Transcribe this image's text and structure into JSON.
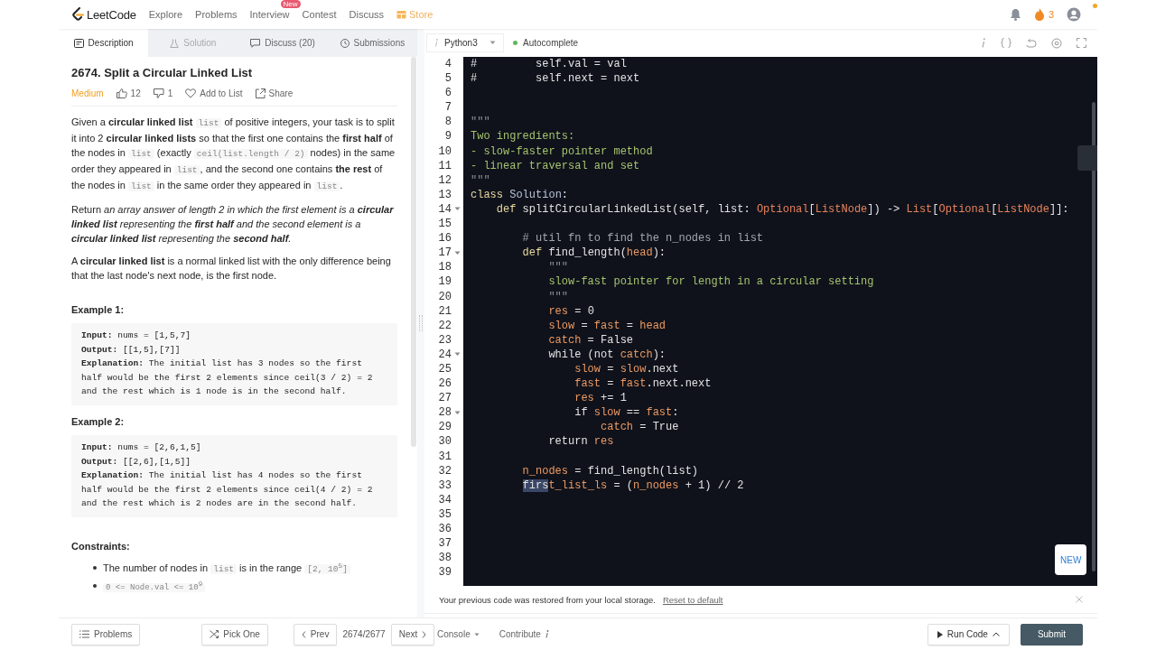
{
  "nav": {
    "logo": "LeetCode",
    "links": [
      {
        "label": "Explore",
        "kind": "link"
      },
      {
        "label": "Problems",
        "kind": "link"
      },
      {
        "label": "Interview",
        "kind": "link",
        "badge": "New"
      },
      {
        "label": "Contest",
        "kind": "link"
      },
      {
        "label": "Discuss",
        "kind": "link"
      },
      {
        "label": "Store",
        "kind": "store"
      }
    ],
    "streak": "3"
  },
  "tabs": [
    {
      "label": "Description",
      "kind": "doc",
      "selected": true,
      "disabled": false
    },
    {
      "label": "Solution",
      "kind": "flask",
      "selected": false,
      "disabled": true
    },
    {
      "label": "Discuss (20)",
      "kind": "chat",
      "selected": false,
      "disabled": false
    },
    {
      "label": "Submissions",
      "kind": "clock",
      "selected": false,
      "disabled": false
    }
  ],
  "problem": {
    "title": "2674. Split a Circular Linked List",
    "difficulty": "Medium",
    "likes": "12",
    "dislikes": "1",
    "add_to_list": "Add to List",
    "share": "Share",
    "paragraphs": [
      [
        {
          "kind": "text",
          "t": "Given a **circular linked list** "
        },
        {
          "kind": "code",
          "t": "list"
        },
        {
          "kind": "text",
          "t": " of positive integers, your task is to split it into 2 **circular linked lists** so that the first one contains the **first half** of the nodes in "
        },
        {
          "kind": "code",
          "t": "list"
        },
        {
          "kind": "text",
          "t": " (exactly "
        },
        {
          "kind": "code",
          "t": "ceil(list.length / 2)"
        },
        {
          "kind": "text",
          "t": " nodes) in the same order they appeared in "
        },
        {
          "kind": "code",
          "t": "list"
        },
        {
          "kind": "text",
          "t": ", and the second one contains **the rest** of the nodes in "
        },
        {
          "kind": "code",
          "t": "list"
        },
        {
          "kind": "text",
          "t": " in the same order they appeared in "
        },
        {
          "kind": "code",
          "t": "list"
        },
        {
          "kind": "text",
          "t": "."
        }
      ],
      [
        {
          "kind": "text",
          "t": "Return "
        },
        {
          "kind": "italic",
          "t": "an array answer of length 2 in which the first element is a **circular linked list** representing the **first half** and the second element is a **circular linked list** representing the **second half**."
        }
      ],
      [
        {
          "kind": "text",
          "t": "A **circular linked list** is a normal linked list with the only difference being that the last node's next node, is the first node."
        }
      ]
    ],
    "examples": [
      {
        "title": "Example 1:",
        "lines": [
          {
            "label": "Input:",
            "value": " nums = [1,5,7]"
          },
          {
            "label": "Output:",
            "value": " [[1,5],[7]]"
          },
          {
            "label": "Explanation:",
            "value": " The initial list has 3 nodes so the first half would be the first 2 elements since ceil(3 / 2) = 2 and the rest which is 1 node is in the second half."
          }
        ]
      },
      {
        "title": "Example 2:",
        "lines": [
          {
            "label": "Input:",
            "value": " nums = [2,6,1,5]"
          },
          {
            "label": "Output:",
            "value": " [[2,6],[1,5]]"
          },
          {
            "label": "Explanation:",
            "value": " The initial list has 4 nodes so the first half would be the first 2 elements since ceil(4 / 2) = 2 and the rest which is 2 nodes are in the second half."
          }
        ]
      }
    ],
    "constraints_title": "Constraints:",
    "constraints": [
      [
        {
          "kind": "text",
          "t": "The number of nodes in "
        },
        {
          "kind": "code",
          "t": "list"
        },
        {
          "kind": "text",
          "t": " is in the range "
        },
        {
          "kind": "code",
          "t": "[2, 10$^{5}$]"
        }
      ],
      [
        {
          "kind": "code",
          "t": "0 <= Node.val <= 10$^{9}$"
        }
      ]
    ]
  },
  "editor": {
    "language": "Python3",
    "autocomplete": {
      "label": "Autocomplete",
      "on": true
    },
    "new_label": "NEW",
    "lines": [
      {
        "num": "4",
        "fold": false,
        "tokens": [
          {
            "kind": "plain",
            "t": "#         self.val = val"
          }
        ]
      },
      {
        "num": "5",
        "fold": false,
        "tokens": [
          {
            "kind": "plain",
            "t": "#         self.next = next"
          }
        ]
      },
      {
        "num": "6",
        "fold": false
      },
      {
        "num": "7",
        "fold": false
      },
      {
        "num": "8",
        "fold": false,
        "tokens": [
          {
            "kind": "quote",
            "t": "\"\"\""
          }
        ]
      },
      {
        "num": "9",
        "fold": false,
        "tokens": [
          {
            "kind": "doc",
            "t": "Two ingredients:"
          }
        ]
      },
      {
        "num": "10",
        "fold": false,
        "tokens": [
          {
            "kind": "doc",
            "t": "- slow-faster pointer method"
          }
        ]
      },
      {
        "num": "11",
        "fold": false,
        "tokens": [
          {
            "kind": "doc",
            "t": "- linear traversal and set"
          }
        ]
      },
      {
        "num": "12",
        "fold": false,
        "tokens": [
          {
            "kind": "quote",
            "t": "\"\"\""
          }
        ]
      },
      {
        "num": "13",
        "fold": false,
        "tokens": [
          {
            "kind": "keyword",
            "t": "class"
          },
          {
            "kind": "classname",
            "t": " Solution"
          },
          {
            "kind": "plain",
            "t": ":"
          }
        ]
      },
      {
        "num": "14",
        "fold": true,
        "tokens": [
          {
            "kind": "keyword",
            "t": "    def"
          },
          {
            "kind": "plain",
            "t": " splitCircularLinkedList(self, list: "
          },
          {
            "kind": "type",
            "t": "Optional"
          },
          {
            "kind": "plain",
            "t": "["
          },
          {
            "kind": "type",
            "t": "ListNode"
          },
          {
            "kind": "plain",
            "t": "]) -> "
          },
          {
            "kind": "type",
            "t": "List"
          },
          {
            "kind": "plain",
            "t": "["
          },
          {
            "kind": "type",
            "t": "Optional"
          },
          {
            "kind": "plain",
            "t": "["
          },
          {
            "kind": "type",
            "t": "ListNode"
          },
          {
            "kind": "plain",
            "t": "]]:"
          }
        ]
      },
      {
        "num": "15",
        "fold": false
      },
      {
        "num": "16",
        "fold": false,
        "tokens": [
          {
            "kind": "comment",
            "t": "        # util fn to find the n_nodes in list"
          }
        ]
      },
      {
        "num": "17",
        "fold": true,
        "tokens": [
          {
            "kind": "keyword",
            "t": "        def"
          },
          {
            "kind": "plain",
            "t": " find_length("
          },
          {
            "kind": "variable",
            "t": "head"
          },
          {
            "kind": "plain",
            "t": "):"
          }
        ]
      },
      {
        "num": "18",
        "fold": false,
        "tokens": [
          {
            "kind": "quote",
            "t": "            \"\"\""
          }
        ]
      },
      {
        "num": "19",
        "fold": false,
        "tokens": [
          {
            "kind": "doc",
            "t": "            slow-fast pointer for length in a circular setting"
          }
        ]
      },
      {
        "num": "20",
        "fold": false,
        "tokens": [
          {
            "kind": "quote",
            "t": "            \"\"\""
          }
        ]
      },
      {
        "num": "21",
        "fold": false,
        "tokens": [
          {
            "kind": "variable",
            "t": "            res"
          },
          {
            "kind": "plain",
            "t": " = 0"
          }
        ]
      },
      {
        "num": "22",
        "fold": false,
        "tokens": [
          {
            "kind": "variable",
            "t": "            slow"
          },
          {
            "kind": "plain",
            "t": " = "
          },
          {
            "kind": "variable",
            "t": "fast"
          },
          {
            "kind": "plain",
            "t": " = "
          },
          {
            "kind": "variable",
            "t": "head"
          }
        ]
      },
      {
        "num": "23",
        "fold": false,
        "tokens": [
          {
            "kind": "variable",
            "t": "            catch"
          },
          {
            "kind": "plain",
            "t": " = False"
          }
        ]
      },
      {
        "num": "24",
        "fold": true,
        "tokens": [
          {
            "kind": "plain",
            "t": "            while (not "
          },
          {
            "kind": "variable",
            "t": "catch"
          },
          {
            "kind": "plain",
            "t": "):"
          }
        ]
      },
      {
        "num": "25",
        "fold": false,
        "tokens": [
          {
            "kind": "variable",
            "t": "                slow"
          },
          {
            "kind": "plain",
            "t": " = "
          },
          {
            "kind": "variable",
            "t": "slow"
          },
          {
            "kind": "plain",
            "t": ".next"
          }
        ]
      },
      {
        "num": "26",
        "fold": false,
        "tokens": [
          {
            "kind": "variable",
            "t": "                fast"
          },
          {
            "kind": "plain",
            "t": " = "
          },
          {
            "kind": "variable",
            "t": "fast"
          },
          {
            "kind": "plain",
            "t": ".next.next"
          }
        ]
      },
      {
        "num": "27",
        "fold": false,
        "tokens": [
          {
            "kind": "variable",
            "t": "                res"
          },
          {
            "kind": "plain",
            "t": " += 1"
          }
        ]
      },
      {
        "num": "28",
        "fold": true,
        "tokens": [
          {
            "kind": "plain",
            "t": "                if "
          },
          {
            "kind": "variable",
            "t": "slow"
          },
          {
            "kind": "plain",
            "t": " == "
          },
          {
            "kind": "variable",
            "t": "fast"
          },
          {
            "kind": "plain",
            "t": ":"
          }
        ]
      },
      {
        "num": "29",
        "fold": false,
        "tokens": [
          {
            "kind": "variable",
            "t": "                    catch"
          },
          {
            "kind": "plain",
            "t": " = True"
          }
        ]
      },
      {
        "num": "30",
        "fold": false,
        "tokens": [
          {
            "kind": "plain",
            "t": "            return "
          },
          {
            "kind": "variable",
            "t": "res"
          }
        ]
      },
      {
        "num": "31",
        "fold": false
      },
      {
        "num": "32",
        "fold": false,
        "tokens": [
          {
            "kind": "variable",
            "t": "        n_nodes"
          },
          {
            "kind": "plain",
            "t": " = find_length(list)"
          }
        ]
      },
      {
        "num": "33",
        "fold": false,
        "tokens": [
          {
            "kind": "selection",
            "t": "        firs"
          },
          {
            "kind": "variable",
            "t": "t_list_ls"
          },
          {
            "kind": "plain",
            "t": " = ("
          },
          {
            "kind": "variable",
            "t": "n_nodes"
          },
          {
            "kind": "plain",
            "t": " + 1) // 2"
          }
        ]
      },
      {
        "num": "34",
        "fold": false
      },
      {
        "num": "35",
        "fold": false
      },
      {
        "num": "36",
        "fold": false
      },
      {
        "num": "37",
        "fold": false
      },
      {
        "num": "38",
        "fold": false
      },
      {
        "num": "39",
        "fold": false
      }
    ]
  },
  "notice": {
    "text": "Your previous code was restored from your local storage.",
    "link": "Reset to default"
  },
  "bottom": {
    "problems": "Problems",
    "pick_one": "Pick One",
    "prev": "Prev",
    "counter": "2674/2677",
    "next": "Next",
    "console": "Console",
    "contribute": "Contribute",
    "run": "Run Code",
    "submit": "Submit"
  }
}
